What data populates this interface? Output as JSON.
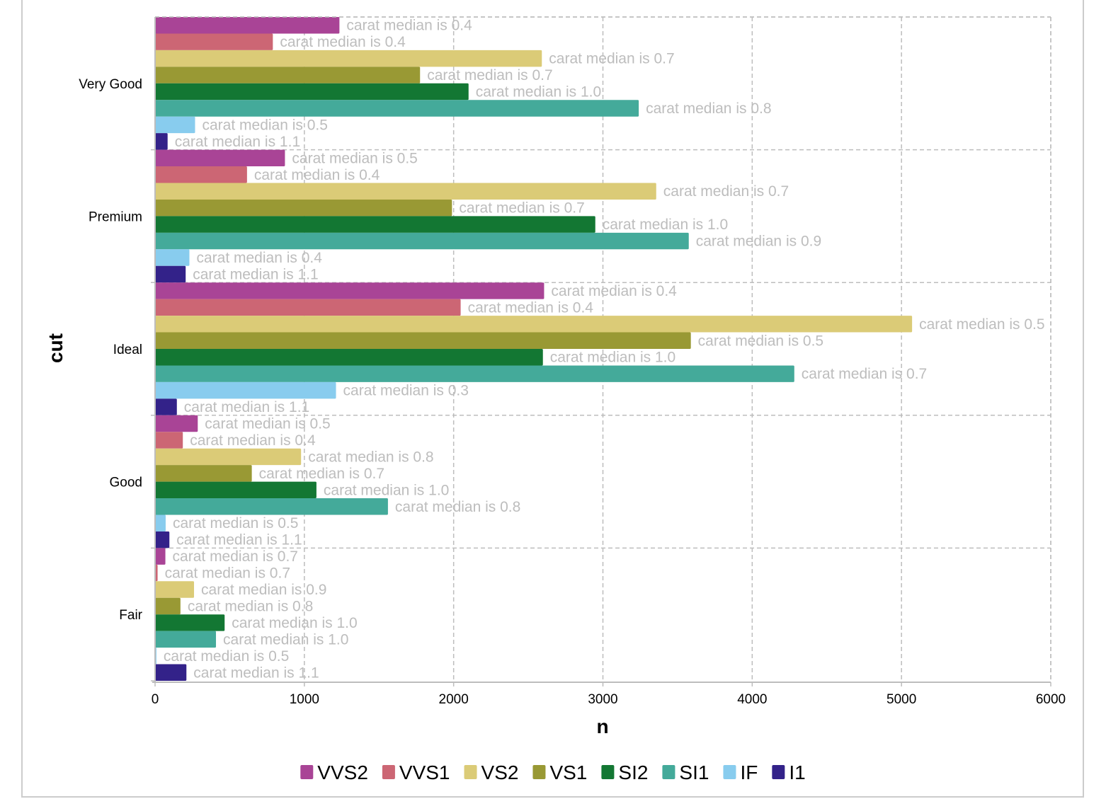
{
  "chart_data": {
    "type": "bar",
    "orientation": "horizontal",
    "title": "",
    "xlabel": "n",
    "ylabel": "cut",
    "xlim": [
      0,
      6000
    ],
    "x_ticks": [
      "0",
      "1000",
      "2000",
      "3000",
      "4000",
      "5000",
      "6000"
    ],
    "grid": true,
    "legend_position": "bottom",
    "categories": [
      "Very Good",
      "Premium",
      "Ideal",
      "Good",
      "Fair"
    ],
    "series": [
      {
        "name": "VVS2",
        "color": "#a94496",
        "values": [
          1235,
          870,
          2606,
          286,
          69
        ],
        "labels": [
          "carat median is 0.4",
          "carat median is 0.5",
          "carat median is 0.4",
          "carat median is 0.5",
          "carat median is 0.7"
        ]
      },
      {
        "name": "VVS1",
        "color": "#cc6674",
        "values": [
          789,
          616,
          2047,
          186,
          17
        ],
        "labels": [
          "carat median is 0.4",
          "carat median is 0.4",
          "carat median is 0.4",
          "carat median is 0.4",
          "carat median is 0.7"
        ]
      },
      {
        "name": "VS2",
        "color": "#dbcb77",
        "values": [
          2591,
          3357,
          5071,
          978,
          261
        ],
        "labels": [
          "carat median is 0.7",
          "carat median is 0.7",
          "carat median is 0.5",
          "carat median is 0.8",
          "carat median is 0.9"
        ]
      },
      {
        "name": "VS1",
        "color": "#999934",
        "values": [
          1775,
          1989,
          3589,
          648,
          170
        ],
        "labels": [
          "carat median is 0.7",
          "carat median is 0.7",
          "carat median is 0.5",
          "carat median is 0.7",
          "carat median is 0.8"
        ]
      },
      {
        "name": "SI2",
        "color": "#137733",
        "values": [
          2100,
          2949,
          2598,
          1081,
          466
        ],
        "labels": [
          "carat median is 1.0",
          "carat median is 1.0",
          "carat median is 1.0",
          "carat median is 1.0",
          "carat median is 1.0"
        ]
      },
      {
        "name": "SI1",
        "color": "#44aa9a",
        "values": [
          3240,
          3575,
          4282,
          1560,
          408
        ],
        "labels": [
          "carat median is 0.8",
          "carat median is 0.9",
          "carat median is 0.7",
          "carat median is 0.8",
          "carat median is 1.0"
        ]
      },
      {
        "name": "IF",
        "color": "#88ccee",
        "values": [
          268,
          230,
          1212,
          71,
          9
        ],
        "labels": [
          "carat median is 0.5",
          "carat median is 0.4",
          "carat median is 0.3",
          "carat median is 0.5",
          "carat median is 0.5"
        ]
      },
      {
        "name": "I1",
        "color": "#332289",
        "values": [
          84,
          205,
          146,
          96,
          210
        ],
        "labels": [
          "carat median is 1.1",
          "carat median is 1.1",
          "carat median is 1.1",
          "carat median is 1.1",
          "carat median is 1.1"
        ]
      }
    ]
  }
}
